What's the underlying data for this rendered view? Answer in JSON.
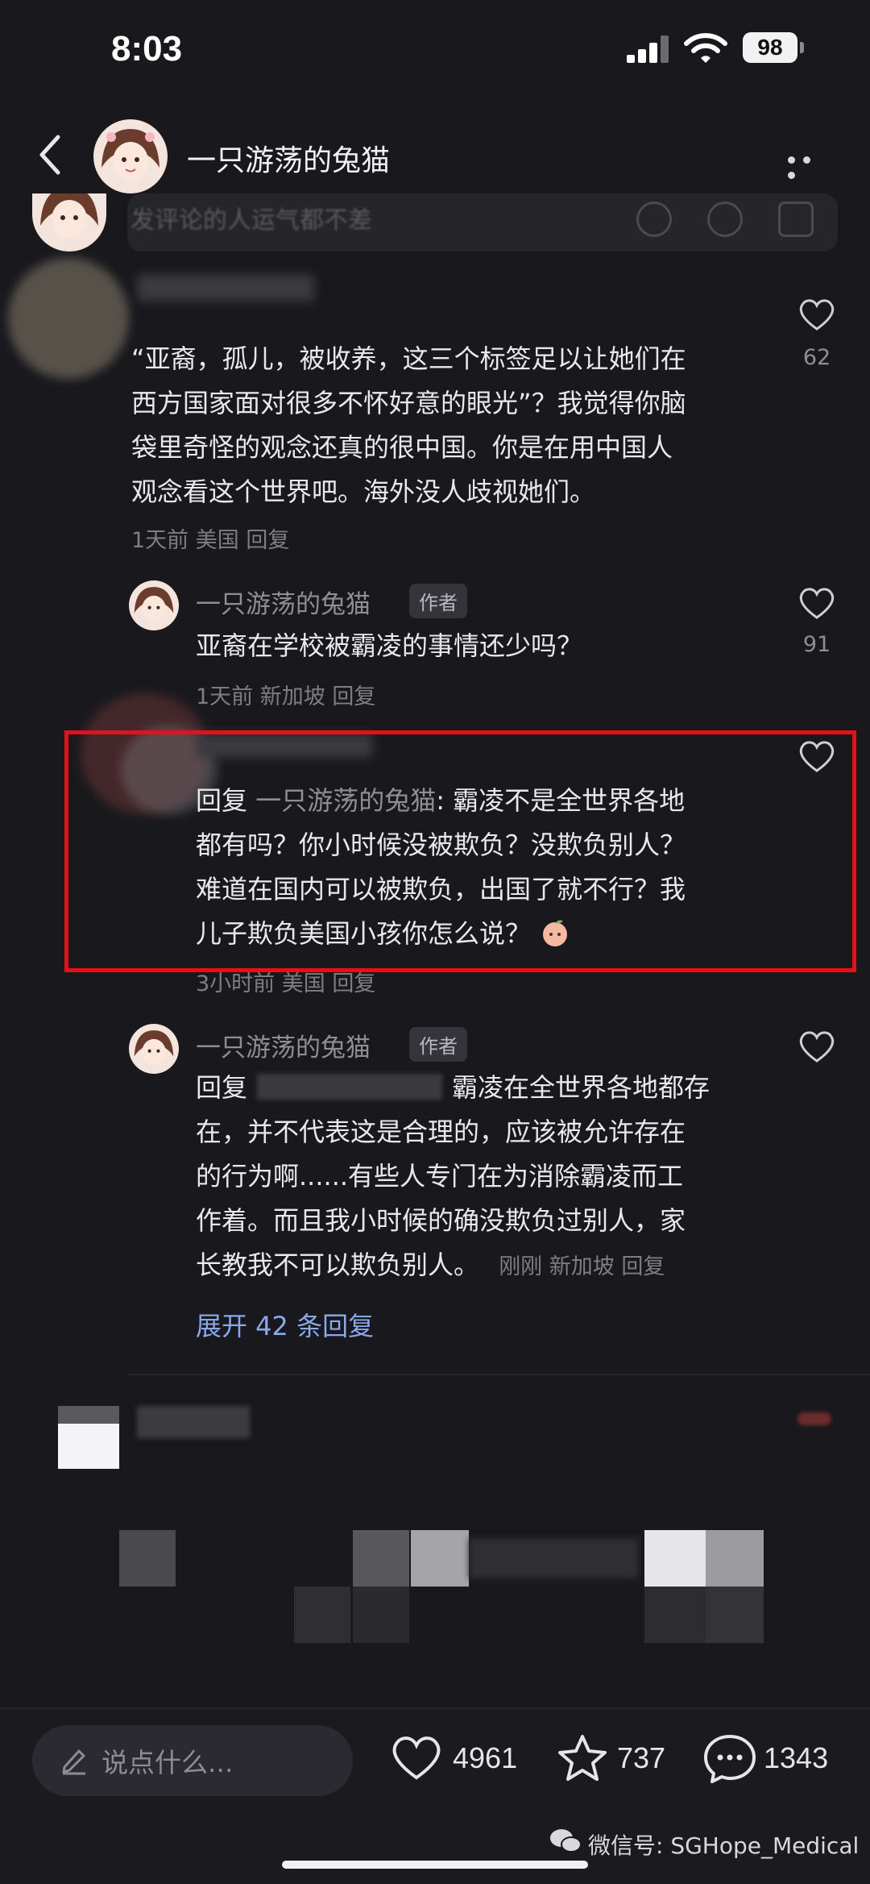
{
  "status_bar": {
    "time": "8:03",
    "battery": "98"
  },
  "header": {
    "title": "一只游荡的兔猫"
  },
  "compose": {
    "hint": "发评论的人运气都不差"
  },
  "comment_main": {
    "lines": [
      "“亚裔，孤儿，被收养，这三个标签足以让她们在",
      "西方国家面对很多不怀好意的眼光”？我觉得你脑",
      "袋里奇怪的观念还真的很中国。你是在用中国人",
      "观念看这个世界吧。海外没人歧视她们。"
    ],
    "meta": "1天前 美国 回复",
    "likes": "62"
  },
  "reply_1": {
    "name": "一只游荡的兔猫",
    "tag": "作者",
    "text": "亚裔在学校被霸凌的事情还少吗？",
    "meta": "1天前 新加坡 回复",
    "likes": "91"
  },
  "reply_2": {
    "reply_prefix": "回复",
    "reply_target": "一只游荡的兔猫",
    "lines": [
      ": 霸凌不是全世界各地",
      "都有吗？你小时候没被欺负？没欺负别人？",
      "难道在国内可以被欺负，出国了就不行？我",
      "儿子欺负美国小孩你怎么说？"
    ],
    "meta": "3小时前 美国 回复"
  },
  "reply_3": {
    "name": "一只游荡的兔猫",
    "tag": "作者",
    "reply_prefix": "回复",
    "lines": [
      "霸凌在全世界各地都存",
      "在，并不代表这是合理的，应该被允许存在",
      "的行为啊......有些人专门在为消除霸凌而工",
      "作着。而且我小时候的确没欺负过别人，家",
      "长教我不可以欺负别人。"
    ],
    "meta": "刚刚 新加坡 回复"
  },
  "expand_label": "展开 42 条回复",
  "bottom_bar": {
    "input_placeholder": "说点什么...",
    "likes": "4961",
    "favorites": "737",
    "comments": "1343"
  },
  "watermark": "微信号: SGHope_Medical",
  "colors": {
    "highlight_border": "#e4101a",
    "link": "#8aa9e8",
    "background": "#19191d"
  }
}
